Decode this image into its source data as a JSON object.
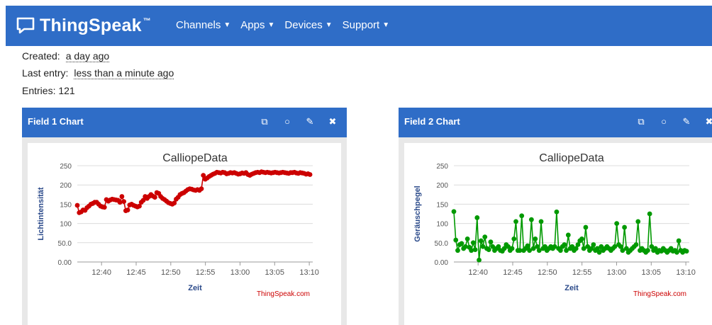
{
  "navbar": {
    "brand": "ThingSpeak",
    "brand_tm": "™",
    "menu": [
      "Channels",
      "Apps",
      "Devices",
      "Support"
    ]
  },
  "meta": {
    "created_label": "Created:",
    "created_value": "a day ago",
    "last_entry_label": "Last entry:",
    "last_entry_value": "less than a minute ago",
    "entries": "Entries: 121"
  },
  "panels": [
    {
      "title": "Field 1 Chart",
      "icons": [
        "external-link-icon",
        "comment-icon",
        "pencil-icon",
        "close-icon"
      ]
    },
    {
      "title": "Field 2 Chart",
      "icons": [
        "external-link-icon",
        "comment-icon",
        "pencil-icon",
        "close-icon"
      ]
    }
  ],
  "colors": {
    "navbar": "#2f6dc7",
    "series1": "#cc0000",
    "series2": "#009900",
    "credit": "#cc0000"
  },
  "chart_data": [
    {
      "type": "line",
      "title": "CalliopeData",
      "xlabel": "Zeit",
      "ylabel": "Lichtintensität",
      "credit": "ThingSpeak.com",
      "xlim": [
        0,
        34
      ],
      "ylim": [
        0,
        250
      ],
      "yticks": [
        0,
        50,
        100,
        150,
        200,
        250
      ],
      "ytick_labels": [
        "0.00",
        "50.0",
        "100",
        "150",
        "200",
        "250"
      ],
      "xticks": [
        3.5,
        8.5,
        13.5,
        18.5,
        23.5,
        28.5,
        33.5
      ],
      "xtick_labels": [
        "12:40",
        "12:45",
        "12:50",
        "12:55",
        "13:00",
        "13:05",
        "13:10"
      ],
      "grid": true,
      "series": [
        {
          "x": [
            0.0,
            0.28,
            0.56,
            0.84,
            1.12,
            1.4,
            1.68,
            1.96,
            2.24,
            2.52,
            2.8,
            3.08,
            3.36,
            3.64,
            3.92,
            4.2,
            4.48,
            4.76,
            5.04,
            5.32,
            5.6,
            5.88,
            6.16,
            6.44,
            6.72,
            7.0,
            7.28,
            7.56,
            7.84,
            8.12,
            8.4,
            8.68,
            8.96,
            9.24,
            9.52,
            9.8,
            10.08,
            10.36,
            10.64,
            10.92,
            11.2,
            11.48,
            11.76,
            12.04,
            12.32,
            12.6,
            12.88,
            13.16,
            13.44,
            13.72,
            14.0,
            14.28,
            14.56,
            14.84,
            15.12,
            15.4,
            15.68,
            15.96,
            16.24,
            16.52,
            16.8,
            17.08,
            17.36,
            17.64,
            17.92,
            18.2,
            18.48,
            18.76,
            19.04,
            19.32,
            19.6,
            19.88,
            20.16,
            20.44,
            20.72,
            21.0,
            21.28,
            21.56,
            21.84,
            22.12,
            22.4,
            22.68,
            22.96,
            23.24,
            23.52,
            23.8,
            24.08,
            24.36,
            24.64,
            24.92,
            25.2,
            25.48,
            25.76,
            26.04,
            26.32,
            26.6,
            26.88,
            27.16,
            27.44,
            27.72,
            28.0,
            28.28,
            28.56,
            28.84,
            29.12,
            29.4,
            29.68,
            29.96,
            30.24,
            30.52,
            30.8,
            31.08,
            31.36,
            31.64,
            31.92,
            32.2,
            32.48,
            32.76,
            33.04,
            33.32,
            33.6
          ],
          "y": [
            147,
            128,
            130,
            135,
            134,
            141,
            145,
            150,
            152,
            155,
            155,
            150,
            145,
            143,
            142,
            162,
            158,
            161,
            163,
            162,
            161,
            160,
            155,
            170,
            157,
            133,
            135,
            148,
            150,
            147,
            145,
            143,
            145,
            155,
            160,
            170,
            165,
            170,
            175,
            171,
            168,
            180,
            178,
            170,
            165,
            162,
            158,
            154,
            152,
            150,
            153,
            163,
            168,
            175,
            178,
            180,
            184,
            188,
            190,
            189,
            187,
            186,
            188,
            186,
            190,
            225,
            215,
            218,
            222,
            225,
            228,
            230,
            233,
            232,
            231,
            233,
            232,
            229,
            230,
            232,
            231,
            232,
            230,
            228,
            229,
            231,
            230,
            232,
            227,
            225,
            228,
            230,
            232,
            233,
            232,
            234,
            233,
            232,
            233,
            232,
            231,
            232,
            233,
            232,
            231,
            232,
            233,
            232,
            231,
            230,
            232,
            232,
            233,
            231,
            230,
            232,
            231,
            230,
            228,
            229,
            227
          ]
        }
      ]
    },
    {
      "type": "line",
      "title": "CalliopeData",
      "xlabel": "Zeit",
      "ylabel": "Geräuschpegel",
      "credit": "ThingSpeak.com",
      "xlim": [
        0,
        34
      ],
      "ylim": [
        0,
        250
      ],
      "yticks": [
        0,
        50,
        100,
        150,
        200,
        250
      ],
      "ytick_labels": [
        "0.00",
        "50.0",
        "100",
        "150",
        "200",
        "250"
      ],
      "xticks": [
        3.5,
        8.5,
        13.5,
        18.5,
        23.5,
        28.5,
        33.5
      ],
      "xtick_labels": [
        "12:40",
        "12:45",
        "12:50",
        "12:55",
        "13:00",
        "13:05",
        "13:10"
      ],
      "grid": true,
      "series": [
        {
          "x": [
            0.0,
            0.28,
            0.56,
            0.84,
            1.12,
            1.4,
            1.68,
            1.96,
            2.24,
            2.52,
            2.8,
            3.08,
            3.36,
            3.64,
            3.92,
            4.2,
            4.48,
            4.76,
            5.04,
            5.32,
            5.6,
            5.88,
            6.16,
            6.44,
            6.72,
            7.0,
            7.28,
            7.56,
            7.84,
            8.12,
            8.4,
            8.68,
            8.96,
            9.24,
            9.52,
            9.8,
            10.08,
            10.36,
            10.64,
            10.92,
            11.2,
            11.48,
            11.76,
            12.04,
            12.32,
            12.6,
            12.88,
            13.16,
            13.44,
            13.72,
            14.0,
            14.28,
            14.56,
            14.84,
            15.12,
            15.4,
            15.68,
            15.96,
            16.24,
            16.52,
            16.8,
            17.08,
            17.36,
            17.64,
            17.92,
            18.2,
            18.48,
            18.76,
            19.04,
            19.32,
            19.6,
            19.88,
            20.16,
            20.44,
            20.72,
            21.0,
            21.28,
            21.56,
            21.84,
            22.12,
            22.4,
            22.68,
            22.96,
            23.24,
            23.52,
            23.8,
            24.08,
            24.36,
            24.64,
            24.92,
            25.2,
            25.48,
            25.76,
            26.04,
            26.32,
            26.6,
            26.88,
            27.16,
            27.44,
            27.72,
            28.0,
            28.28,
            28.56,
            28.84,
            29.12,
            29.4,
            29.68,
            29.96,
            30.24,
            30.52,
            30.8,
            31.08,
            31.36,
            31.64,
            31.92,
            32.2,
            32.48,
            32.76,
            33.04,
            33.32,
            33.6
          ],
          "y": [
            131,
            57,
            30,
            45,
            48,
            35,
            40,
            60,
            38,
            30,
            50,
            32,
            115,
            5,
            55,
            40,
            65,
            35,
            32,
            52,
            40,
            30,
            35,
            40,
            30,
            28,
            35,
            45,
            40,
            30,
            35,
            60,
            105,
            30,
            30,
            120,
            30,
            35,
            42,
            30,
            110,
            35,
            60,
            40,
            30,
            105,
            35,
            40,
            30,
            35,
            40,
            35,
            40,
            130,
            35,
            30,
            40,
            45,
            30,
            70,
            35,
            40,
            30,
            35,
            45,
            55,
            60,
            35,
            90,
            40,
            30,
            35,
            45,
            30,
            35,
            25,
            40,
            30,
            35,
            40,
            35,
            30,
            35,
            40,
            100,
            45,
            40,
            30,
            90,
            35,
            25,
            30,
            35,
            40,
            45,
            105,
            30,
            35,
            30,
            25,
            30,
            125,
            40,
            30,
            35,
            25,
            30,
            28,
            35,
            30,
            25,
            30,
            35,
            28,
            30,
            25,
            55,
            30,
            25,
            30,
            28
          ]
        }
      ]
    }
  ]
}
